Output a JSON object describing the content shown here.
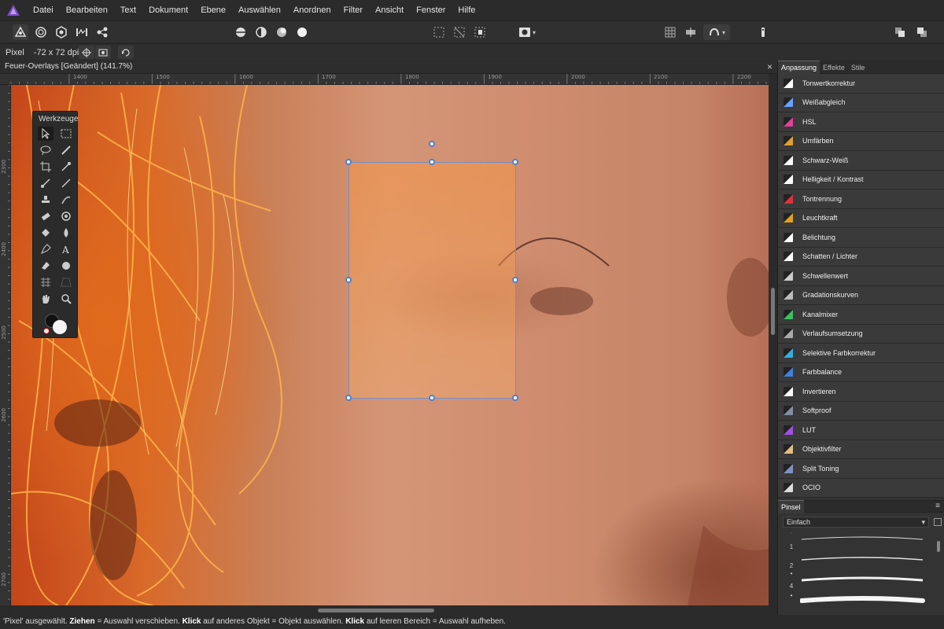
{
  "menubar": {
    "items": [
      "Datei",
      "Bearbeiten",
      "Text",
      "Dokument",
      "Ebene",
      "Auswählen",
      "Anordnen",
      "Filter",
      "Ansicht",
      "Fenster",
      "Hilfe"
    ]
  },
  "toolbar": {
    "persona_icons": [
      "photo-persona-icon",
      "liquify-persona-icon",
      "develop-persona-icon",
      "tone-mapping-persona-icon",
      "export-persona-icon"
    ],
    "view_icons": [
      "view-mode-icon",
      "half-circle-icon",
      "circle-shade-icon",
      "white-circle-icon"
    ],
    "selection_icons": [
      "marquee-icon",
      "deselect-icon",
      "invert-selection-icon"
    ],
    "mask_icon": "quick-mask-icon",
    "snapping_icons": [
      "grid-icon",
      "align-icon",
      "snapping-icon"
    ],
    "assistant_icon": "assistant-icon",
    "arrange_icons": [
      "arrange-back-icon",
      "arrange-front-icon"
    ]
  },
  "context": {
    "label": "Pixel",
    "dpi": "-72 x 72 dpi"
  },
  "document": {
    "title": "Feuer-Overlays [Geändert] (141.7%)",
    "close": "×"
  },
  "rulers": {
    "top_ticks": [
      "1400",
      "1500",
      "1600",
      "1700",
      "1800",
      "1900",
      "2000",
      "2100",
      "2200"
    ],
    "left_ticks": [
      "2300",
      "2400",
      "2500",
      "2600",
      "2700"
    ]
  },
  "tools_panel": {
    "title": "Werkzeuge"
  },
  "right_panel": {
    "tabs": [
      "Anpassung",
      "Effekte",
      "Stile"
    ],
    "active_tab": "Anpassung",
    "adjustments": [
      {
        "label": "Tonwertkorrektur",
        "icon": "levels-icon",
        "color": "#ffffff"
      },
      {
        "label": "Weißabgleich",
        "icon": "white-balance-icon",
        "color": "#6aa0ff"
      },
      {
        "label": "HSL",
        "icon": "hsl-icon",
        "color": "#e0409a"
      },
      {
        "label": "Umfärben",
        "icon": "recolor-icon",
        "color": "#e0a030"
      },
      {
        "label": "Schwarz-Weiß",
        "icon": "black-white-icon",
        "color": "#ffffff"
      },
      {
        "label": "Helligkeit / Kontrast",
        "icon": "brightness-contrast-icon",
        "color": "#ffffff"
      },
      {
        "label": "Tontrennung",
        "icon": "posterize-icon",
        "color": "#e03040"
      },
      {
        "label": "Leuchtkraft",
        "icon": "vibrance-icon",
        "color": "#e0a020"
      },
      {
        "label": "Belichtung",
        "icon": "exposure-icon",
        "color": "#ffffff"
      },
      {
        "label": "Schatten / Lichter",
        "icon": "shadows-highlights-icon",
        "color": "#ffffff"
      },
      {
        "label": "Schwellenwert",
        "icon": "threshold-icon",
        "color": "#cccccc"
      },
      {
        "label": "Gradationskurven",
        "icon": "curves-icon",
        "color": "#bbbbbb"
      },
      {
        "label": "Kanalmixer",
        "icon": "channel-mixer-icon",
        "color": "#40c060"
      },
      {
        "label": "Verlaufsumsetzung",
        "icon": "gradient-map-icon",
        "color": "#aaaaaa"
      },
      {
        "label": "Selektive Farbkorrektur",
        "icon": "selective-color-icon",
        "color": "#30b0e0"
      },
      {
        "label": "Farbbalance",
        "icon": "color-balance-icon",
        "color": "#4080e0"
      },
      {
        "label": "Invertieren",
        "icon": "invert-icon",
        "color": "#ffffff"
      },
      {
        "label": "Softproof",
        "icon": "soft-proof-icon",
        "color": "#8090a0"
      },
      {
        "label": "LUT",
        "icon": "lut-icon",
        "color": "#a050e0"
      },
      {
        "label": "Objektivfilter",
        "icon": "lens-filter-icon",
        "color": "#e0c080"
      },
      {
        "label": "Split Toning",
        "icon": "split-toning-icon",
        "color": "#8090c0"
      },
      {
        "label": "OCIO",
        "icon": "ocio-icon",
        "color": "#dddddd"
      }
    ]
  },
  "brush_panel": {
    "tab": "Pinsel",
    "menu_icon": "≡",
    "category": "Einfach",
    "dropdown_chevron": "▾",
    "brushes": [
      "1",
      "2",
      "4",
      "•"
    ]
  },
  "status": {
    "text_1": "'Pixel' ausgewählt.",
    "b1": "Ziehen",
    "text_2": "= Auswahl verschieben.",
    "b2": "Klick",
    "text_3": "auf anderes Objekt = Objekt auswählen.",
    "b3": "Klick",
    "text_4": "auf leeren Bereich = Auswahl aufheben."
  }
}
